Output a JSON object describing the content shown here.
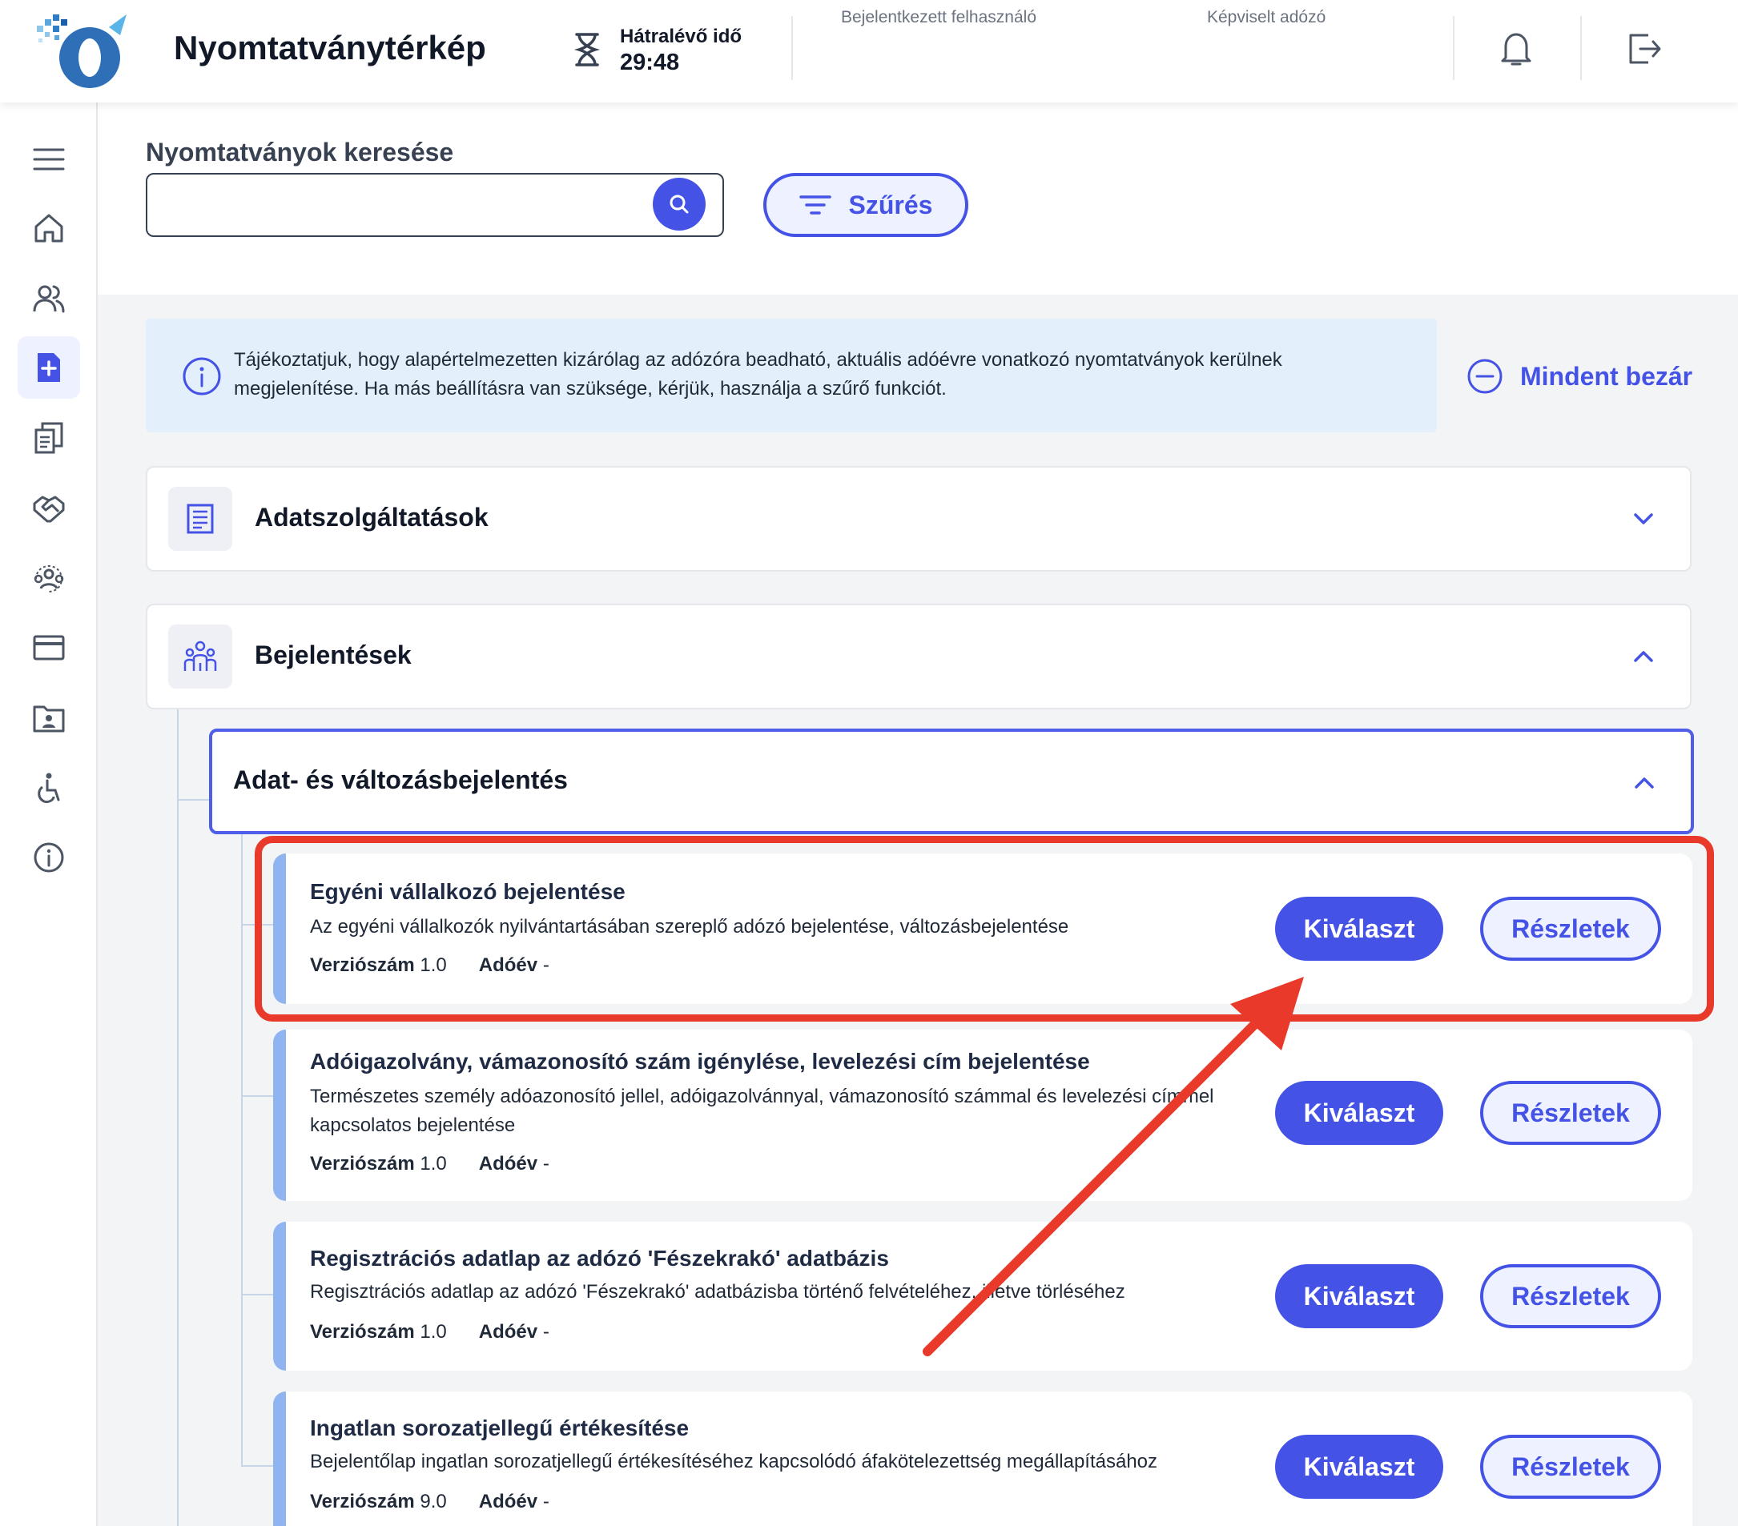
{
  "header": {
    "app_title": "Nyomtatványtérkép",
    "timer_label": "Hátralévő idő",
    "timer_value": "29:48",
    "logged_in_user_label": "Bejelentkezett felhasználó",
    "represented_taxpayer_label": "Képviselt adózó"
  },
  "sidebar": {
    "items": [
      {
        "icon": "menu-icon"
      },
      {
        "icon": "home-icon"
      },
      {
        "icon": "users-icon"
      },
      {
        "icon": "new-form-icon",
        "active": true
      },
      {
        "icon": "documents-icon"
      },
      {
        "icon": "handshake-icon"
      },
      {
        "icon": "group-icon"
      },
      {
        "icon": "card-icon"
      },
      {
        "icon": "contact-folder-icon"
      },
      {
        "icon": "accessibility-icon"
      },
      {
        "icon": "info-icon"
      }
    ]
  },
  "search": {
    "label": "Nyomtatványok keresése",
    "value": "",
    "placeholder": "",
    "filter_label": "Szűrés"
  },
  "info_box": {
    "text": "Tájékoztatjuk, hogy alapértelmezetten kizárólag az adózóra beadható, aktuális adóévre vonatkozó nyomtatványok kerülnek megjelenítése. Ha más beállításra van szüksége, kérjük, használja a szűrő funkciót.",
    "close_all_label": "Mindent bezár"
  },
  "sections": [
    {
      "title": "Adatszolgáltatások",
      "expanded": false
    },
    {
      "title": "Bejelentések",
      "expanded": true
    }
  ],
  "subsection": {
    "title": "Adat- és változásbejelentés",
    "expanded": true
  },
  "cards": [
    {
      "title": "Egyéni vállalkozó bejelentése",
      "description": "Az egyéni vállalkozók nyilvántartásában szereplő adózó bejelentése, változásbejelentése",
      "version_label": "Verziószám",
      "version": "1.0",
      "year_label": "Adóév",
      "year": "-",
      "select_label": "Kiválaszt",
      "details_label": "Részletek"
    },
    {
      "title": "Adóigazolvány, vámazonosító szám igénylése, levelezési cím bejelentése",
      "description": "Természetes személy adóazonosító jellel, adóigazolvánnyal, vámazonosító számmal és levelezési címmel kapcsolatos bejelentése",
      "version_label": "Verziószám",
      "version": "1.0",
      "year_label": "Adóév",
      "year": "-",
      "select_label": "Kiválaszt",
      "details_label": "Részletek"
    },
    {
      "title": "Regisztrációs adatlap az adózó 'Fészekrakó' adatbázis",
      "description": "Regisztrációs adatlap az adózó 'Fészekrakó' adatbázisba történő felvételéhez, illetve törléséhez",
      "version_label": "Verziószám",
      "version": "1.0",
      "year_label": "Adóév",
      "year": "-",
      "select_label": "Kiválaszt",
      "details_label": "Részletek"
    },
    {
      "title": "Ingatlan sorozatjellegű értékesítése",
      "description": "Bejelentőlap ingatlan sorozatjellegű értékesítéséhez kapcsolódó áfakötelezettség megállapításához",
      "version_label": "Verziószám",
      "version": "9.0",
      "year_label": "Adóév",
      "year": "-",
      "select_label": "Kiválaszt",
      "details_label": "Részletek"
    }
  ],
  "colors": {
    "accent": "#4453e6",
    "annotation": "#e8392a",
    "info_bg": "#e3effb",
    "card_stripe": "#8fb4f0"
  }
}
